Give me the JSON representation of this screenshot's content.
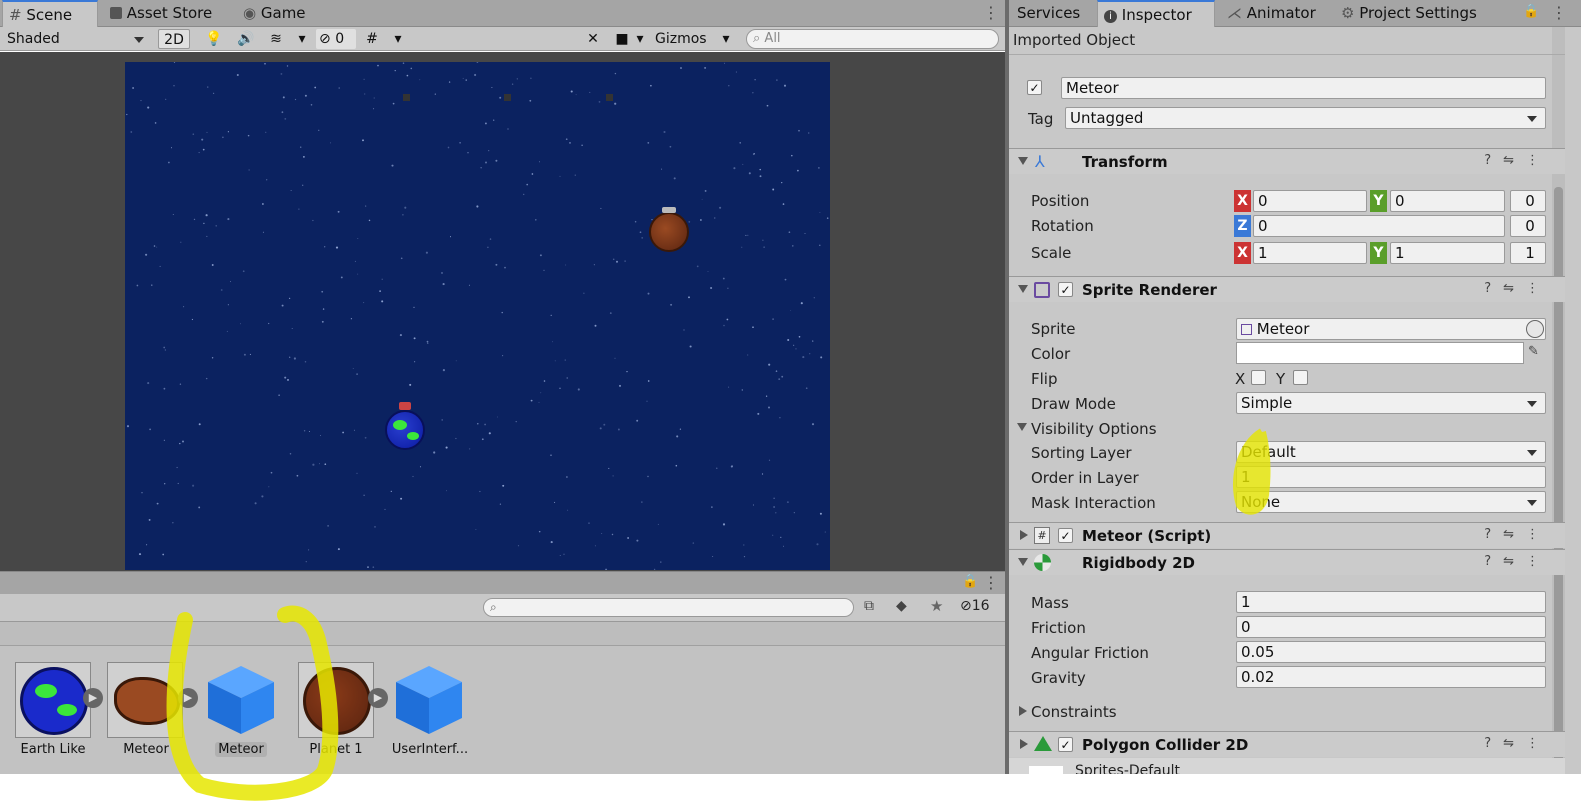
{
  "scene_tabs": {
    "scene": "Scene",
    "asset_store": "Asset Store",
    "game": "Game"
  },
  "scene_toolbar": {
    "shading": "Shaded",
    "mode_2d": "2D",
    "hidden_count": "0",
    "gizmos": "Gizmos",
    "search_placeholder": "All"
  },
  "project": {
    "hidden_count": "16"
  },
  "assets": [
    {
      "label": "Earth Like"
    },
    {
      "label": "Meteor"
    },
    {
      "label": "Meteor"
    },
    {
      "label": "Planet 1"
    },
    {
      "label": "UserInterf..."
    }
  ],
  "inspector_tabs": {
    "services": "Services",
    "inspector": "Inspector",
    "animator": "Animator",
    "project_settings": "Project Settings"
  },
  "inspector": {
    "header": "Imported Object",
    "object_name": "Meteor",
    "tag_label": "Tag",
    "tag_value": "Untagged",
    "transform": {
      "title": "Transform",
      "position_label": "Position",
      "position": {
        "x": "0",
        "y": "0",
        "z": "0"
      },
      "rotation_label": "Rotation",
      "rotation": {
        "z": "0",
        "w": "0"
      },
      "scale_label": "Scale",
      "scale": {
        "x": "1",
        "y": "1",
        "z": "1"
      }
    },
    "sprite_renderer": {
      "title": "Sprite Renderer",
      "sprite_label": "Sprite",
      "sprite_value": "Meteor",
      "color_label": "Color",
      "flip_label": "Flip",
      "flip_x": "X",
      "flip_y": "Y",
      "draw_mode_label": "Draw Mode",
      "draw_mode": "Simple",
      "visibility_label": "Visibility Options",
      "sorting_layer_label": "Sorting Layer",
      "sorting_layer": "Default",
      "order_label": "Order in Layer",
      "order": "1",
      "mask_label": "Mask Interaction",
      "mask": "None"
    },
    "meteor_script": {
      "title": "Meteor (Script)"
    },
    "rigidbody": {
      "title": "Rigidbody 2D",
      "mass_label": "Mass",
      "mass": "1",
      "friction_label": "Friction",
      "friction": "0",
      "angular_label": "Angular Friction",
      "angular": "0.05",
      "gravity_label": "Gravity",
      "gravity": "0.02",
      "constraints_label": "Constraints"
    },
    "polygon": {
      "title": "Polygon Collider 2D",
      "material": "Sprites-Default"
    }
  },
  "colors": {
    "accent": "#3a79d7",
    "space": "#0b2260",
    "highlight": "#e6e600"
  }
}
